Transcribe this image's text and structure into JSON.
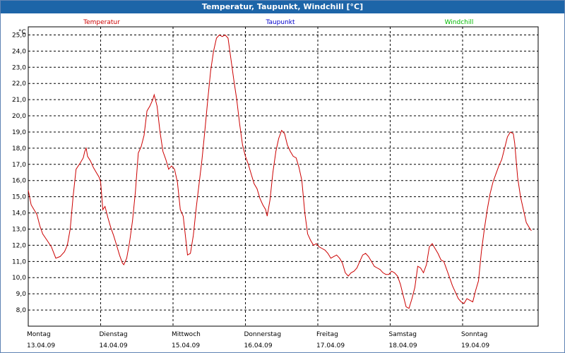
{
  "window": {
    "title": "Temperatur, Taupunkt, Windchill [°C]"
  },
  "colors": {
    "temperature": "#cc0000",
    "dewpoint": "#0000cc",
    "windchill": "#00bb00",
    "grid": "#000000",
    "titlebar": "#1d65a8"
  },
  "chart_data": {
    "type": "line",
    "title": "Temperatur, Taupunkt, Windchill [°C]",
    "ylabel": "°C",
    "ylim": [
      7.0,
      25.5
    ],
    "yticks": [
      "25,0",
      "24,0",
      "23,0",
      "22,0",
      "21,0",
      "20,0",
      "19,0",
      "18,0",
      "17,0",
      "16,0",
      "15,0",
      "14,0",
      "13,0",
      "12,0",
      "11,0",
      "10,0",
      "9,0",
      "8,0"
    ],
    "xlim": [
      0,
      7
    ],
    "days": [
      {
        "name": "Montag",
        "date": "13.04.09"
      },
      {
        "name": "Dienstag",
        "date": "14.04.09"
      },
      {
        "name": "Mittwoch",
        "date": "15.04.09"
      },
      {
        "name": "Donnerstag",
        "date": "16.04.09"
      },
      {
        "name": "Freitag",
        "date": "17.04.09"
      },
      {
        "name": "Samstag",
        "date": "18.04.09"
      },
      {
        "name": "Sonntag",
        "date": "19.04.09"
      }
    ],
    "legend": [
      "Temperatur",
      "Taupunkt",
      "Windchill"
    ],
    "series": [
      {
        "name": "Temperatur",
        "color": "#cc0000",
        "points": [
          [
            0.0,
            15.4
          ],
          [
            0.04,
            14.5
          ],
          [
            0.08,
            14.2
          ],
          [
            0.12,
            13.9
          ],
          [
            0.16,
            13.2
          ],
          [
            0.2,
            12.7
          ],
          [
            0.26,
            12.3
          ],
          [
            0.32,
            11.9
          ],
          [
            0.38,
            11.2
          ],
          [
            0.44,
            11.3
          ],
          [
            0.5,
            11.6
          ],
          [
            0.54,
            12.0
          ],
          [
            0.58,
            13.0
          ],
          [
            0.62,
            15.0
          ],
          [
            0.66,
            16.7
          ],
          [
            0.72,
            17.1
          ],
          [
            0.76,
            17.4
          ],
          [
            0.78,
            17.8
          ],
          [
            0.8,
            18.0
          ],
          [
            0.82,
            17.5
          ],
          [
            0.86,
            17.2
          ],
          [
            0.9,
            16.8
          ],
          [
            0.94,
            16.5
          ],
          [
            0.98,
            16.2
          ],
          [
            1.0,
            15.9
          ],
          [
            1.03,
            14.2
          ],
          [
            1.06,
            14.4
          ],
          [
            1.1,
            13.7
          ],
          [
            1.14,
            13.1
          ],
          [
            1.18,
            12.6
          ],
          [
            1.22,
            12.0
          ],
          [
            1.26,
            11.4
          ],
          [
            1.3,
            10.9
          ],
          [
            1.32,
            10.8
          ],
          [
            1.36,
            11.2
          ],
          [
            1.4,
            12.2
          ],
          [
            1.44,
            13.5
          ],
          [
            1.48,
            15.3
          ],
          [
            1.52,
            17.7
          ],
          [
            1.56,
            18.1
          ],
          [
            1.6,
            18.8
          ],
          [
            1.64,
            20.3
          ],
          [
            1.68,
            20.6
          ],
          [
            1.72,
            21.0
          ],
          [
            1.74,
            21.3
          ],
          [
            1.78,
            20.6
          ],
          [
            1.82,
            19.0
          ],
          [
            1.86,
            17.8
          ],
          [
            1.9,
            17.3
          ],
          [
            1.94,
            16.7
          ],
          [
            1.98,
            16.9
          ],
          [
            2.02,
            16.7
          ],
          [
            2.06,
            15.9
          ],
          [
            2.1,
            14.2
          ],
          [
            2.14,
            13.8
          ],
          [
            2.18,
            12.2
          ],
          [
            2.2,
            11.4
          ],
          [
            2.24,
            11.5
          ],
          [
            2.28,
            12.6
          ],
          [
            2.32,
            14.3
          ],
          [
            2.36,
            15.8
          ],
          [
            2.4,
            17.3
          ],
          [
            2.44,
            19.1
          ],
          [
            2.48,
            21.0
          ],
          [
            2.52,
            22.8
          ],
          [
            2.56,
            24.0
          ],
          [
            2.6,
            24.8
          ],
          [
            2.64,
            25.0
          ],
          [
            2.68,
            24.9
          ],
          [
            2.72,
            25.0
          ],
          [
            2.76,
            24.8
          ],
          [
            2.8,
            23.5
          ],
          [
            2.84,
            22.2
          ],
          [
            2.88,
            21.0
          ],
          [
            2.92,
            19.5
          ],
          [
            2.96,
            18.2
          ],
          [
            3.0,
            17.5
          ],
          [
            3.04,
            17.0
          ],
          [
            3.08,
            16.4
          ],
          [
            3.12,
            15.8
          ],
          [
            3.16,
            15.5
          ],
          [
            3.2,
            14.9
          ],
          [
            3.24,
            14.5
          ],
          [
            3.28,
            14.2
          ],
          [
            3.3,
            13.8
          ],
          [
            3.34,
            14.8
          ],
          [
            3.38,
            16.5
          ],
          [
            3.42,
            17.8
          ],
          [
            3.46,
            18.6
          ],
          [
            3.5,
            19.1
          ],
          [
            3.54,
            18.9
          ],
          [
            3.58,
            18.2
          ],
          [
            3.62,
            17.8
          ],
          [
            3.66,
            17.5
          ],
          [
            3.7,
            17.4
          ],
          [
            3.74,
            16.8
          ],
          [
            3.78,
            16.0
          ],
          [
            3.82,
            14.0
          ],
          [
            3.86,
            12.7
          ],
          [
            3.9,
            12.3
          ],
          [
            3.94,
            12.0
          ],
          [
            3.98,
            12.1
          ],
          [
            4.02,
            11.9
          ],
          [
            4.06,
            11.8
          ],
          [
            4.1,
            11.7
          ],
          [
            4.14,
            11.5
          ],
          [
            4.18,
            11.2
          ],
          [
            4.22,
            11.3
          ],
          [
            4.26,
            11.4
          ],
          [
            4.3,
            11.2
          ],
          [
            4.34,
            10.9
          ],
          [
            4.38,
            10.3
          ],
          [
            4.42,
            10.1
          ],
          [
            4.46,
            10.3
          ],
          [
            4.5,
            10.4
          ],
          [
            4.54,
            10.6
          ],
          [
            4.58,
            11.0
          ],
          [
            4.62,
            11.4
          ],
          [
            4.66,
            11.5
          ],
          [
            4.7,
            11.3
          ],
          [
            4.74,
            11.0
          ],
          [
            4.78,
            10.7
          ],
          [
            4.82,
            10.6
          ],
          [
            4.86,
            10.5
          ],
          [
            4.9,
            10.3
          ],
          [
            4.94,
            10.2
          ],
          [
            4.98,
            10.2
          ],
          [
            5.02,
            10.4
          ],
          [
            5.06,
            10.3
          ],
          [
            5.1,
            10.1
          ],
          [
            5.14,
            9.6
          ],
          [
            5.18,
            8.9
          ],
          [
            5.22,
            8.2
          ],
          [
            5.26,
            8.1
          ],
          [
            5.3,
            8.7
          ],
          [
            5.34,
            9.4
          ],
          [
            5.38,
            10.7
          ],
          [
            5.42,
            10.6
          ],
          [
            5.46,
            10.3
          ],
          [
            5.5,
            10.8
          ],
          [
            5.54,
            11.9
          ],
          [
            5.58,
            12.1
          ],
          [
            5.62,
            11.8
          ],
          [
            5.66,
            11.5
          ],
          [
            5.7,
            11.1
          ],
          [
            5.74,
            11.0
          ],
          [
            5.78,
            10.5
          ],
          [
            5.82,
            10.0
          ],
          [
            5.86,
            9.5
          ],
          [
            5.9,
            9.1
          ],
          [
            5.94,
            8.7
          ],
          [
            5.98,
            8.5
          ],
          [
            6.02,
            8.4
          ],
          [
            6.06,
            8.7
          ],
          [
            6.1,
            8.6
          ],
          [
            6.14,
            8.5
          ],
          [
            6.18,
            9.2
          ],
          [
            6.22,
            9.8
          ],
          [
            6.26,
            11.6
          ],
          [
            6.3,
            13.0
          ],
          [
            6.34,
            14.2
          ],
          [
            6.38,
            15.2
          ],
          [
            6.42,
            15.9
          ],
          [
            6.46,
            16.4
          ],
          [
            6.5,
            16.9
          ],
          [
            6.54,
            17.3
          ],
          [
            6.58,
            18.0
          ],
          [
            6.62,
            18.7
          ],
          [
            6.66,
            19.0
          ],
          [
            6.7,
            18.9
          ],
          [
            6.72,
            18.3
          ],
          [
            6.76,
            16.2
          ],
          [
            6.8,
            15.0
          ],
          [
            6.84,
            14.2
          ],
          [
            6.88,
            13.4
          ],
          [
            6.92,
            13.1
          ],
          [
            6.95,
            12.9
          ]
        ]
      }
    ],
    "grid": true
  }
}
